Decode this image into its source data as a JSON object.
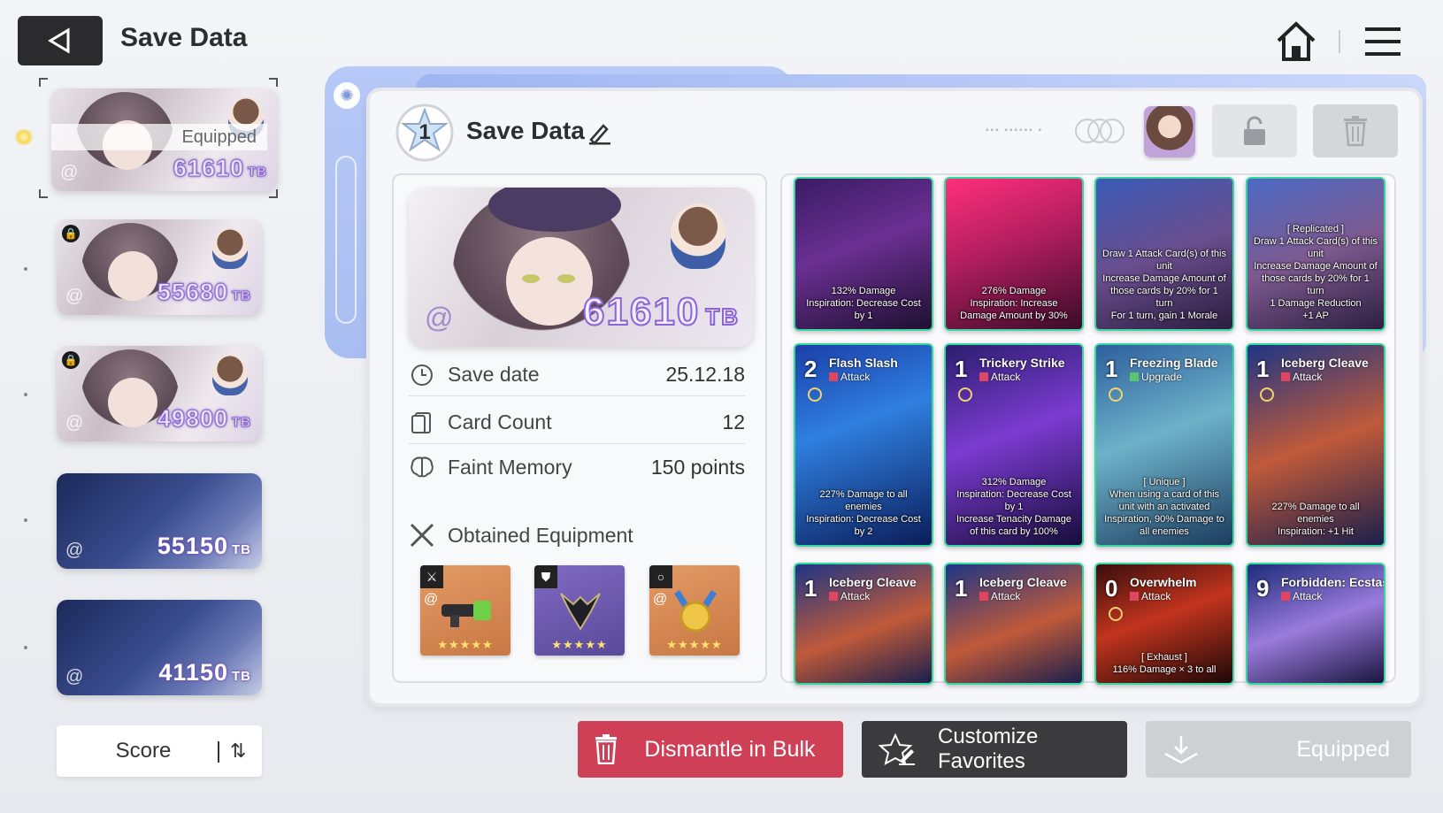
{
  "header": {
    "title": "Save Data",
    "back_icon": "triangle-left-icon",
    "home_icon": "house-icon",
    "menu_icon": "hamburger-icon"
  },
  "save_slots": [
    {
      "score": "61610",
      "unit": "TB",
      "equipped_label": "Equipped",
      "locked": false,
      "selected": true
    },
    {
      "score": "55680",
      "unit": "TB",
      "locked": true
    },
    {
      "score": "49800",
      "unit": "TB",
      "locked": true
    },
    {
      "score": "55150",
      "unit": "TB",
      "locked": false
    },
    {
      "score": "41150",
      "unit": "TB",
      "locked": false
    }
  ],
  "sort": {
    "label": "Score"
  },
  "detail": {
    "level": "1",
    "name": "Save Data",
    "hero_score": "61610",
    "hero_unit": "TB",
    "stats": [
      {
        "label": "Save date",
        "value": "25.12.18"
      },
      {
        "label": "Card Count",
        "value": "12"
      },
      {
        "label": "Faint Memory",
        "value": "150 points"
      }
    ],
    "equipment_title": "Obtained Equipment",
    "equipment_stars": "★★★★★"
  },
  "cards": [
    {
      "cost": "",
      "name": "",
      "type": "",
      "desc": "132% Damage\nInspiration: Decrease Cost by 1",
      "bg": "linear-gradient(160deg,#3a1c64 0%,#6b2f93 45%,#1f1030 100%)"
    },
    {
      "cost": "",
      "name": "",
      "type": "",
      "desc": "276% Damage\nInspiration: Increase Damage Amount by 30%",
      "bg": "linear-gradient(160deg,#ff2f7a 0%,#b21e5e 45%,#3a0c28 100%)"
    },
    {
      "cost": "",
      "name": "",
      "type": "",
      "desc": "Draw 1 Attack Card(s) of this unit\nIncrease Damage Amount of those cards by 20% for 1 turn\nFor 1 turn, gain 1 Morale",
      "bg": "linear-gradient(160deg,#3b5bb8 0%,#6a4e8e 50%,#2a1c3e 100%)"
    },
    {
      "cost": "",
      "name": "",
      "type": "",
      "desc": "[ Replicated ]\nDraw 1 Attack Card(s) of this unit\nIncrease Damage Amount of those cards by 20% for 1 turn\n1 Damage Reduction\n+1 AP",
      "bg": "linear-gradient(160deg,#4c6ac5 0%,#7d5a90 50%,#2d1f40 100%)"
    },
    {
      "cost": "2",
      "name": "Flash Slash",
      "type": "Attack",
      "desc": "227% Damage to all enemies\nInspiration: Decrease Cost by 2",
      "bg": "linear-gradient(160deg,#1b3fa8 0%,#2f7fe0 40%,#0b1d5a 100%)"
    },
    {
      "cost": "1",
      "name": "Trickery Strike",
      "type": "Attack",
      "desc": "312% Damage\nInspiration: Decrease Cost by 1\nIncrease Tenacity Damage of this card by 100%",
      "bg": "linear-gradient(160deg,#2a1e6e 0%,#7c3bd1 45%,#160d3a 100%)"
    },
    {
      "cost": "1",
      "name": "Freezing Blade",
      "type": "Upgrade",
      "upgrade": true,
      "desc": "[ Unique ]\nWhen using a card of this unit with an activated Inspiration, 90% Damage to all enemies",
      "bg": "linear-gradient(160deg,#2d5f9e 0%,#6db2c9 45%,#1c3c5e 100%)"
    },
    {
      "cost": "1",
      "name": "Iceberg Cleave",
      "type": "Attack",
      "desc": "227% Damage to all enemies\nInspiration: +1 Hit",
      "bg": "linear-gradient(160deg,#1d3585 0%,#c05a3a 50%,#1a1f4c 100%)"
    },
    {
      "cost": "1",
      "name": "Iceberg Cleave",
      "type": "Attack",
      "desc": "",
      "bg": "linear-gradient(160deg,#1d3585 0%,#c05a3a 55%,#1a1f4c 100%)"
    },
    {
      "cost": "1",
      "name": "Iceberg Cleave",
      "type": "Attack",
      "desc": "",
      "bg": "linear-gradient(160deg,#1d3585 0%,#c05a3a 55%,#1a1f4c 100%)"
    },
    {
      "cost": "0",
      "name": "Overwhelm",
      "type": "Attack",
      "desc": "[ Exhaust ]\n116% Damage × 3 to all",
      "bg": "linear-gradient(160deg,#3a0d0d 0%,#c2341e 45%,#1e0808 100%)"
    },
    {
      "cost": "9",
      "name": "Forbidden: Ecstasy of Violence",
      "type": "Attack",
      "desc": "",
      "bg": "linear-gradient(160deg,#1c2c7a 0%,#9a7bdc 50%,#1a1540 100%)"
    }
  ],
  "buttons": {
    "dismantle": "Dismantle in Bulk",
    "favorites": "Customize Favorites",
    "equipped": "Equipped"
  },
  "colors": {
    "dismantle": "#cf3f55",
    "favorites": "#3b3b3e",
    "equipped_disabled": "#cfd0d4",
    "panel_accent": "#a8bdf1"
  }
}
